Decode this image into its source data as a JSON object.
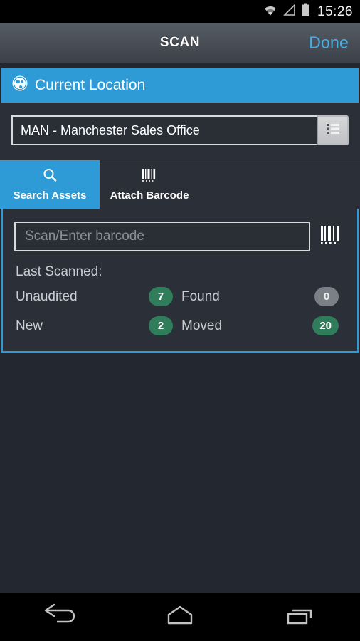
{
  "statusbar": {
    "time": "15:26",
    "icons": [
      "wifi-icon",
      "signal-icon",
      "battery-icon"
    ]
  },
  "titlebar": {
    "title": "SCAN",
    "done_label": "Done"
  },
  "section_header": {
    "label": "Current Location",
    "icon": "globe-icon",
    "background": "#2e9bd6"
  },
  "location": {
    "value": "MAN - Manchester Sales Office",
    "picker_icon": "list-icon"
  },
  "tabs": [
    {
      "label": "Search Assets",
      "icon": "search-icon",
      "active": true
    },
    {
      "label": "Attach Barcode",
      "icon": "barcode-icon",
      "active": false
    }
  ],
  "scan": {
    "placeholder": "Scan/Enter barcode",
    "value": "",
    "scan_icon": "barcode-icon",
    "last_scanned_label": "Last Scanned:"
  },
  "stats": [
    {
      "label": "Unaudited",
      "count": "7",
      "color": "green"
    },
    {
      "label": "Found",
      "count": "0",
      "color": "grey"
    },
    {
      "label": "New",
      "count": "2",
      "color": "green"
    },
    {
      "label": "Moved",
      "count": "20",
      "color": "green"
    }
  ],
  "navbar": [
    {
      "icon": "back-icon"
    },
    {
      "icon": "home-icon"
    },
    {
      "icon": "recents-icon"
    }
  ],
  "colors": {
    "accent_blue": "#2e9bd6",
    "link_blue": "#4aaee0",
    "badge_green": "#2f7d5b",
    "badge_grey": "#7b7f86",
    "panel_bg": "#2b3038",
    "page_bg": "#232830"
  }
}
